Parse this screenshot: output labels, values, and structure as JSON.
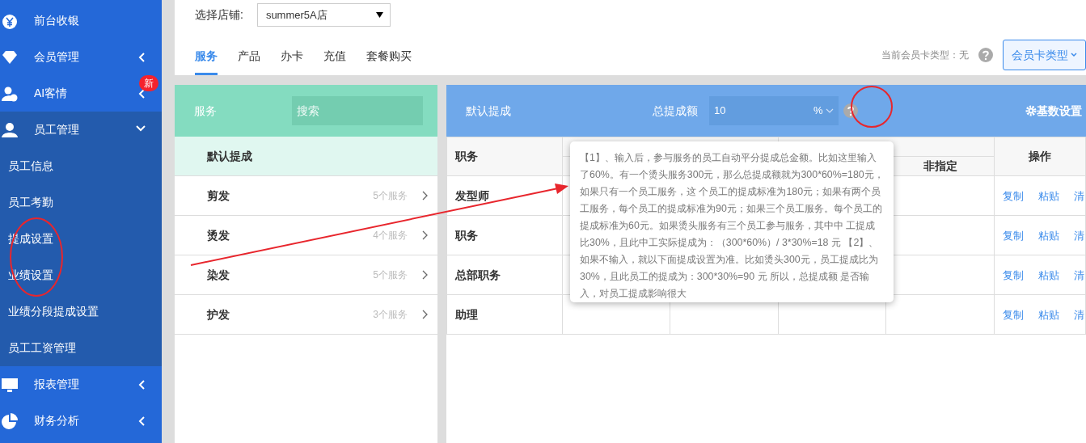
{
  "sidebar": {
    "items": [
      {
        "label": "前台收银",
        "expandable": false
      },
      {
        "label": "会员管理",
        "expandable": true,
        "expanded": false
      },
      {
        "label": "AI客情",
        "expandable": true,
        "expanded": false,
        "badge": "新"
      },
      {
        "label": "员工管理",
        "expandable": true,
        "expanded": true,
        "children": [
          {
            "label": "员工信息"
          },
          {
            "label": "员工考勤"
          },
          {
            "label": "提成设置"
          },
          {
            "label": "业绩设置"
          },
          {
            "label": "业绩分段提成设置"
          },
          {
            "label": "员工工资管理"
          }
        ]
      },
      {
        "label": "报表管理",
        "expandable": true,
        "expanded": false
      },
      {
        "label": "财务分析",
        "expandable": true,
        "expanded": false
      }
    ]
  },
  "store": {
    "label": "选择店铺:",
    "value": "summer5A店"
  },
  "tabs": [
    {
      "label": "服务",
      "selected": true
    },
    {
      "label": "产品",
      "selected": false
    },
    {
      "label": "办卡",
      "selected": false
    },
    {
      "label": "充值",
      "selected": false
    },
    {
      "label": "套餐购买",
      "selected": false
    }
  ],
  "member_card": {
    "label": "当前会员卡类型：无",
    "button": "会员卡类型"
  },
  "left_panel": {
    "title": "服务",
    "search_placeholder": "搜索",
    "default_item": {
      "label": "默认提成",
      "selected": true
    },
    "categories": [
      {
        "name": "剪发",
        "count": "5个服务"
      },
      {
        "name": "烫发",
        "count": "4个服务"
      },
      {
        "name": "染发",
        "count": "5个服务"
      },
      {
        "name": "护发",
        "count": "3个服务"
      }
    ]
  },
  "right_panel": {
    "title": "默认提成",
    "total_label": "总提成额",
    "total_value": "10",
    "unit": "%",
    "settings_button": "基数设置",
    "table": {
      "columns": [
        "职务",
        "非指定",
        "操作"
      ],
      "rows": [
        {
          "role": "发型师",
          "actions": [
            "复制",
            "粘贴",
            "清"
          ]
        },
        {
          "role": "职务",
          "actions": [
            "复制",
            "粘贴",
            "清"
          ]
        },
        {
          "role": "总部职务",
          "actions": [
            "复制",
            "粘贴",
            "清"
          ]
        },
        {
          "role": "助理",
          "actions": [
            "复制",
            "粘贴",
            "清"
          ]
        }
      ]
    }
  },
  "tooltip": {
    "text": "【1】、输入后，参与服务的员工自动平分提成总金额。比如这里输入了60%。有一个烫头服务300元，那么总提成额就为300*60%=180元，如果只有一个员工服务，这 个员工的提成标准为180元；如果有两个员工服务，每个员工的提成标准为90元；如果三个员工服务。每个员工的提成标准为60元。如果烫头服务有三个员工参与服务，其中中 工提成比30%，且此中工实际提成为：（300*60%）/ 3*30%=18 元 【2】、如果不输入，就以下面提成设置为准。比如烫头300元，员工提成比为30%，且此员工的提成为：300*30%=90 元 所以，总提成额 是否输入，对员工提成影响很大"
  }
}
